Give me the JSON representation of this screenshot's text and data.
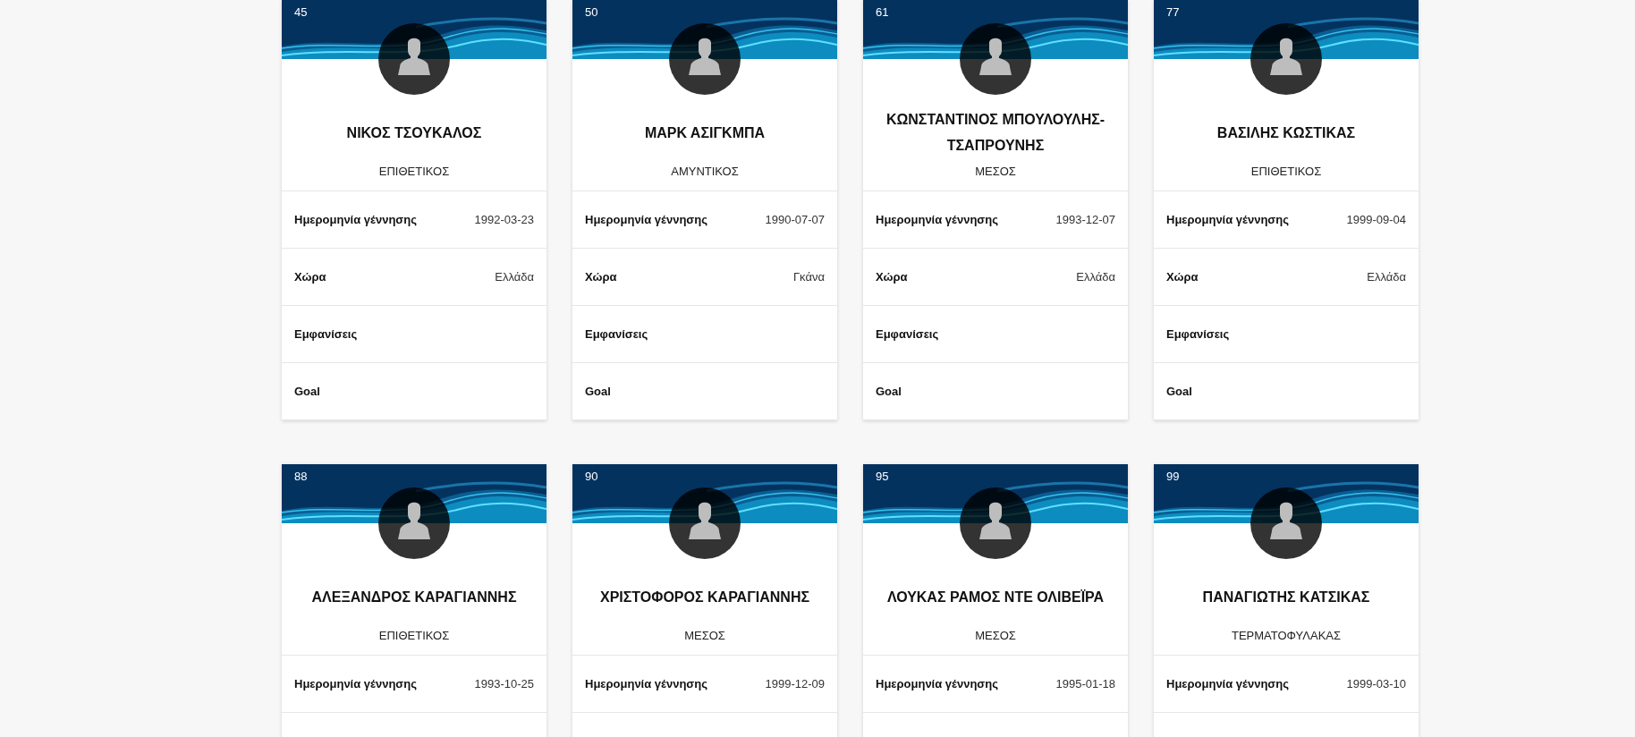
{
  "players": [
    {
      "number": "45",
      "name": "ΝΙΚΟΣ ΤΣΟΥΚΑΛΟΣ",
      "position": "ΕΠΙΘΕΤΙΚΟΣ",
      "rows": [
        {
          "label": "Ημερομηνία γέννησης",
          "value": "1992-03-23"
        },
        {
          "label": "Χώρα",
          "value": "Ελλάδα"
        },
        {
          "label": "Εμφανίσεις"
        },
        {
          "label": "Goal"
        }
      ]
    },
    {
      "number": "50",
      "name": "ΜΑΡΚ ΑΣΙΓΚΜΠΑ",
      "position": "ΑΜΥΝΤΙΚΟΣ",
      "rows": [
        {
          "label": "Ημερομηνία γέννησης",
          "value": "1990-07-07"
        },
        {
          "label": "Χώρα",
          "value": "Γκάνα"
        },
        {
          "label": "Εμφανίσεις"
        },
        {
          "label": "Goal"
        }
      ]
    },
    {
      "number": "61",
      "name": "ΚΩΝΣΤΑΝΤΙΝΟΣ ΜΠΟΥΛΟΥΛΗΣ-ΤΣΑΠΡΟΥΝΗΣ",
      "position": "ΜΕΣΟΣ",
      "rows": [
        {
          "label": "Ημερομηνία γέννησης",
          "value": "1993-12-07"
        },
        {
          "label": "Χώρα",
          "value": "Ελλάδα"
        },
        {
          "label": "Εμφανίσεις"
        },
        {
          "label": "Goal"
        }
      ]
    },
    {
      "number": "77",
      "name": "ΒΑΣΙΛΗΣ ΚΩΣΤΙΚΑΣ",
      "position": "ΕΠΙΘΕΤΙΚΟΣ",
      "rows": [
        {
          "label": "Ημερομηνία γέννησης",
          "value": "1999-09-04"
        },
        {
          "label": "Χώρα",
          "value": "Ελλάδα"
        },
        {
          "label": "Εμφανίσεις"
        },
        {
          "label": "Goal"
        }
      ]
    },
    {
      "number": "88",
      "name": "ΑΛΕΞΑΝΔΡΟΣ ΚΑΡΑΓΙΑΝΝΗΣ",
      "position": "ΕΠΙΘΕΤΙΚΟΣ",
      "rows": [
        {
          "label": "Ημερομηνία γέννησης",
          "value": "1993-10-25"
        }
      ]
    },
    {
      "number": "90",
      "name": "ΧΡΙΣΤΟΦΟΡΟΣ ΚΑΡΑΓΙΑΝΝΗΣ",
      "position": "ΜΕΣΟΣ",
      "rows": [
        {
          "label": "Ημερομηνία γέννησης",
          "value": "1999-12-09"
        }
      ]
    },
    {
      "number": "95",
      "name": "ΛΟΥΚΑΣ ΡΑΜΟΣ ΝΤΕ ΟΛΙΒΕΪΡΑ",
      "position": "ΜΕΣΟΣ",
      "rows": [
        {
          "label": "Ημερομηνία γέννησης",
          "value": "1995-01-18"
        }
      ]
    },
    {
      "number": "99",
      "name": "ΠΑΝΑΓΙΩΤΗΣ ΚΑΤΣΙΚΑΣ",
      "position": "ΤΕΡΜΑΤΟΦΥΛΑΚΑΣ",
      "rows": [
        {
          "label": "Ημερομηνία γέννησης",
          "value": "1999-03-10"
        }
      ]
    }
  ]
}
